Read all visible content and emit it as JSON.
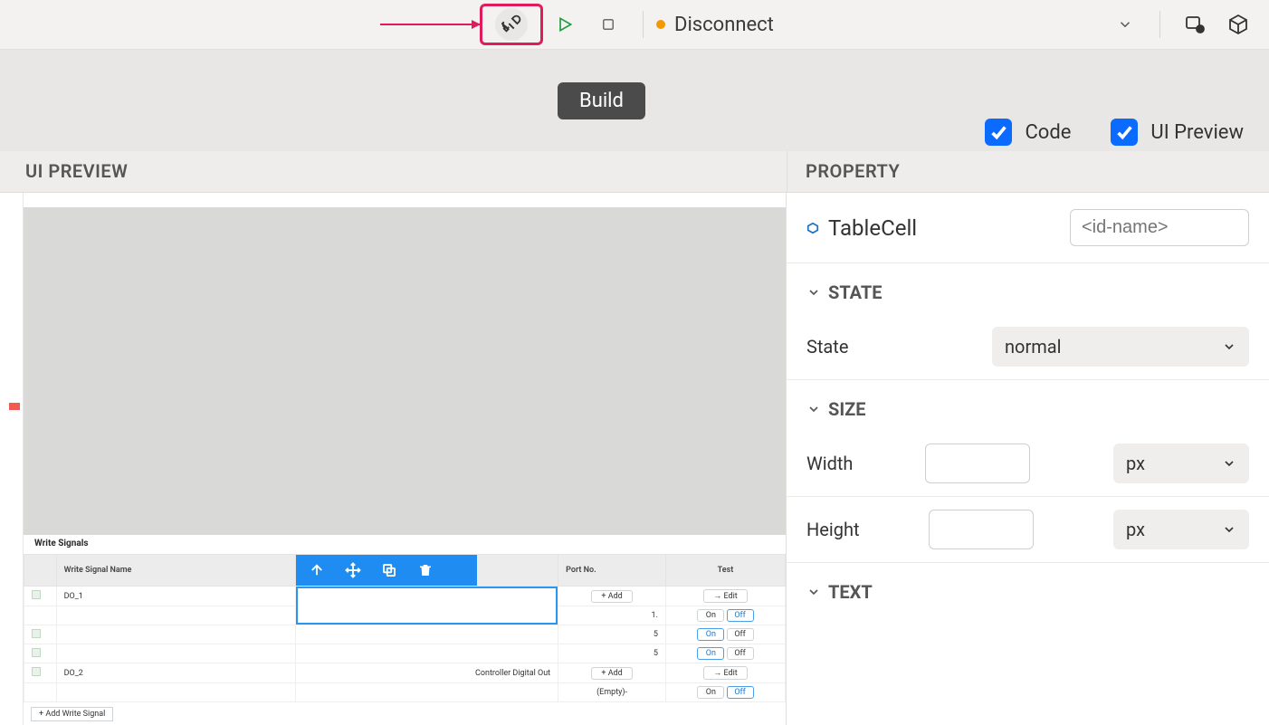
{
  "toolbar": {
    "disconnect": "Disconnect",
    "build_tooltip": "Build"
  },
  "checks": {
    "code": "Code",
    "ui_preview": "UI Preview"
  },
  "headers": {
    "preview": "UI PREVIEW",
    "property": "PROPERTY"
  },
  "preview": {
    "section": "Write Signals",
    "cols": {
      "name": "Write Signal Name",
      "port": "Port No.",
      "test": "Test"
    },
    "rows": {
      "do1": "DO_1",
      "do2": "DO_2",
      "ctrl": "Controller Digital Out",
      "add": "+ Add",
      "edit": "→ Edit",
      "on": "On",
      "off": "Off",
      "one": "1.",
      "five": "5",
      "empty": "(Empty)-"
    },
    "addsig": "+ Add Write Signal"
  },
  "property": {
    "component": "TableCell",
    "id_placeholder": "<id-name>",
    "sections": {
      "state": "STATE",
      "size": "SIZE",
      "text": "TEXT"
    },
    "labels": {
      "state": "State",
      "width": "Width",
      "height": "Height"
    },
    "values": {
      "state": "normal",
      "px": "px"
    }
  }
}
